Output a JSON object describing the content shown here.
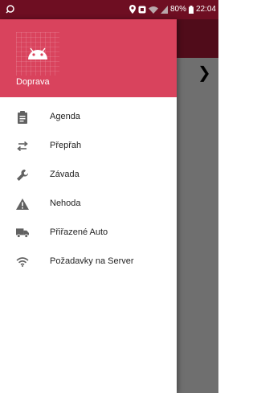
{
  "status_bar": {
    "battery_text": "80%",
    "time": "22:04"
  },
  "drawer": {
    "header": {
      "title": "Doprava",
      "logo_icon": "android-icon"
    },
    "items": [
      {
        "label": "Agenda",
        "icon": "clipboard-icon"
      },
      {
        "label": "Přepřah",
        "icon": "swap-arrows-icon"
      },
      {
        "label": "Závada",
        "icon": "wrench-icon"
      },
      {
        "label": "Nehoda",
        "icon": "warning-icon"
      },
      {
        "label": "Přiřazené Auto",
        "icon": "truck-icon"
      },
      {
        "label": "Požadavky na Server",
        "icon": "wifi-icon"
      }
    ]
  },
  "app": {
    "next_icon": "chevron-right-icon"
  },
  "colors": {
    "header": "#d9435d",
    "toolbar": "#b21c3a",
    "status_bar": "#6e0e22",
    "icon": "#616161"
  }
}
